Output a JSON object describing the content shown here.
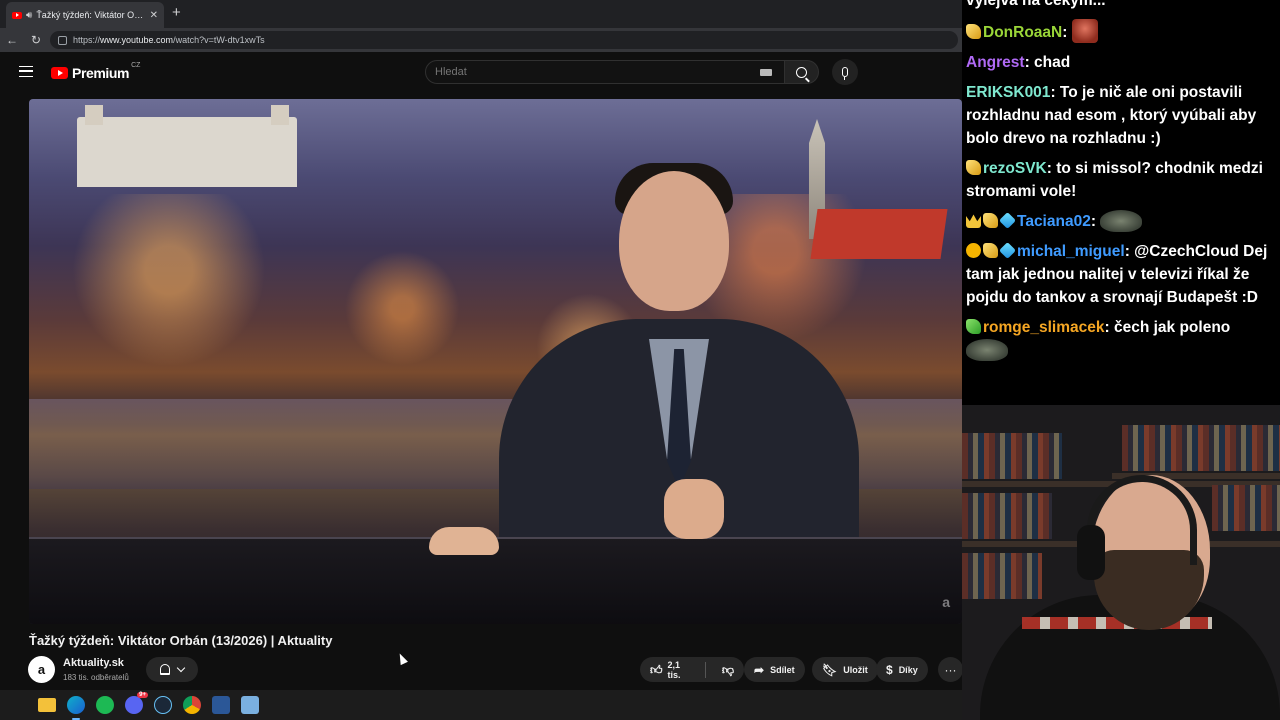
{
  "browser": {
    "tab_title": "Ťažký týždeň: Viktátor Orbán |",
    "url_scheme": "https://",
    "url_host": "www.youtube.com",
    "url_path": "/watch?v=tW-dtv1xwTs"
  },
  "youtube": {
    "logo_text": "Premium",
    "logo_country": "CZ",
    "search_placeholder": "Hledat"
  },
  "video": {
    "title": "Ťažký týždeň: Viktátor Orbán (13/2026) | Aktuality",
    "watermark": "a",
    "channel_initial": "a",
    "channel_name": "Aktuality.sk",
    "subscribers": "183 tis. odběratelů",
    "likes": "2,1 tis.",
    "share_label": "Sdílet",
    "save_label": "Uložit",
    "thanks_label": "Díky",
    "more_label": "···"
  },
  "taskbar": {
    "discord_badge": "9+"
  },
  "chat": {
    "top_text": "vylejva na cekym...",
    "messages": [
      {
        "user": "DonRoaaN",
        "color": "#9ad638",
        "text": ""
      },
      {
        "user": "Angrest",
        "color": "#b069f5",
        "text": "chad"
      },
      {
        "user": "ERIKSK001",
        "color": "#7fe8cf",
        "text": "To je nič ale oni postavili rozhladnu nad esom , ktorý vyúbali aby bolo drevo na rozhladnu :)"
      },
      {
        "user": "rezoSVK",
        "color": "#7fe8cf",
        "text": "to si missol? chodnik medzi stromami vole!"
      },
      {
        "user": "Taciana02",
        "color": "#3f9bff",
        "text": ""
      },
      {
        "user": "michal_miguel",
        "color": "#3f9bff",
        "text": "@CzechCloud Dej tam jak jednou nalitej v televizi říkal že pojdu do tankov a srovnají Budapešt :D"
      },
      {
        "user": "romge_slimacek",
        "color": "#f5a623",
        "text": "čech jak poleno"
      }
    ]
  }
}
